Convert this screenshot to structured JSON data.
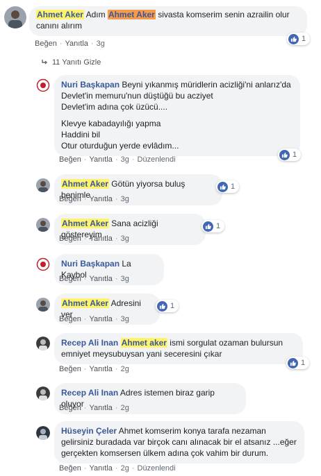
{
  "comments": [
    {
      "author": "Ahmet Aker",
      "text_pre": "Adım ",
      "mention": "Ahmet Aker",
      "text_post": " sivasta komserim senin azrailin olur canını alırım",
      "likes": "1",
      "actions": {
        "like": "Beğen",
        "reply": "Yanıtla",
        "time": "3g"
      }
    }
  ],
  "replies_toggle": {
    "label": "11 Yanıtı Gizle"
  },
  "replies": [
    {
      "author": "Nuri Başkapan",
      "lines_1": [
        "Beyni yıkanmış müridlerin acizliği'ni anlarız'da",
        "Devlet'in memuru'nun düştüğü bu acziyet",
        "Devlet'im adına çok üzücü...."
      ],
      "lines_2": [
        "Klevye kabadayılığı yapma",
        "Haddini bil",
        "Otur oturduğun yerde evlâdım..."
      ],
      "likes": "1",
      "actions": {
        "like": "Beğen",
        "reply": "Yanıtla",
        "time": "3g",
        "edited": "Düzenlendi"
      }
    },
    {
      "author": "Ahmet Aker",
      "text": "Götün yiyorsa buluş benimle",
      "likes": "1",
      "actions": {
        "like": "Beğen",
        "reply": "Yanıtla",
        "time": "3g"
      }
    },
    {
      "author": "Ahmet Aker",
      "text": "Sana acizliği göstereyim",
      "likes": "1",
      "actions": {
        "like": "Beğen",
        "reply": "Yanıtla",
        "time": "3g"
      }
    },
    {
      "author": "Nuri Başkapan",
      "text": "La Kaybol",
      "actions": {
        "like": "Beğen",
        "reply": "Yanıtla",
        "time": "3g"
      }
    },
    {
      "author": "Ahmet Aker",
      "text": "Adresini ver",
      "likes": "1",
      "actions": {
        "like": "Beğen",
        "reply": "Yanıtla",
        "time": "3g"
      }
    },
    {
      "author": "Recep Ali Inan",
      "mention": "Ahmet aker",
      "text_line1": " ismi sorgulat ozaman bulursun",
      "text_line2": "emniyet meysubuysan yani seceresini çıkar",
      "likes": "1",
      "actions": {
        "like": "Beğen",
        "reply": "Yanıtla",
        "time": "2g"
      }
    },
    {
      "author": "Recep Ali Inan",
      "text": "Adres istemen biraz garip oluyor",
      "actions": {
        "like": "Beğen",
        "reply": "Yanıtla",
        "time": "2g"
      }
    },
    {
      "author": "Hüseyin Çeler",
      "text_line1": " Ahmet komserim konya tarafa nezaman",
      "text_line2": "gelirsiniz buradada var birçok canı alınacak bir el atsanız ...eğer",
      "text_line3": "gerçekten komsersen ülkem adına çok vahim bir durum.",
      "actions": {
        "like": "Beğen",
        "reply": "Yanıtla",
        "time": "2g",
        "edited": "Düzenlendi"
      }
    }
  ],
  "colors": {
    "author": "#385898",
    "bubble": "#f2f3f5",
    "mention_yellow": "#fff36b",
    "mention_orange": "#f79a4a",
    "like_blue": "#4267b2"
  }
}
